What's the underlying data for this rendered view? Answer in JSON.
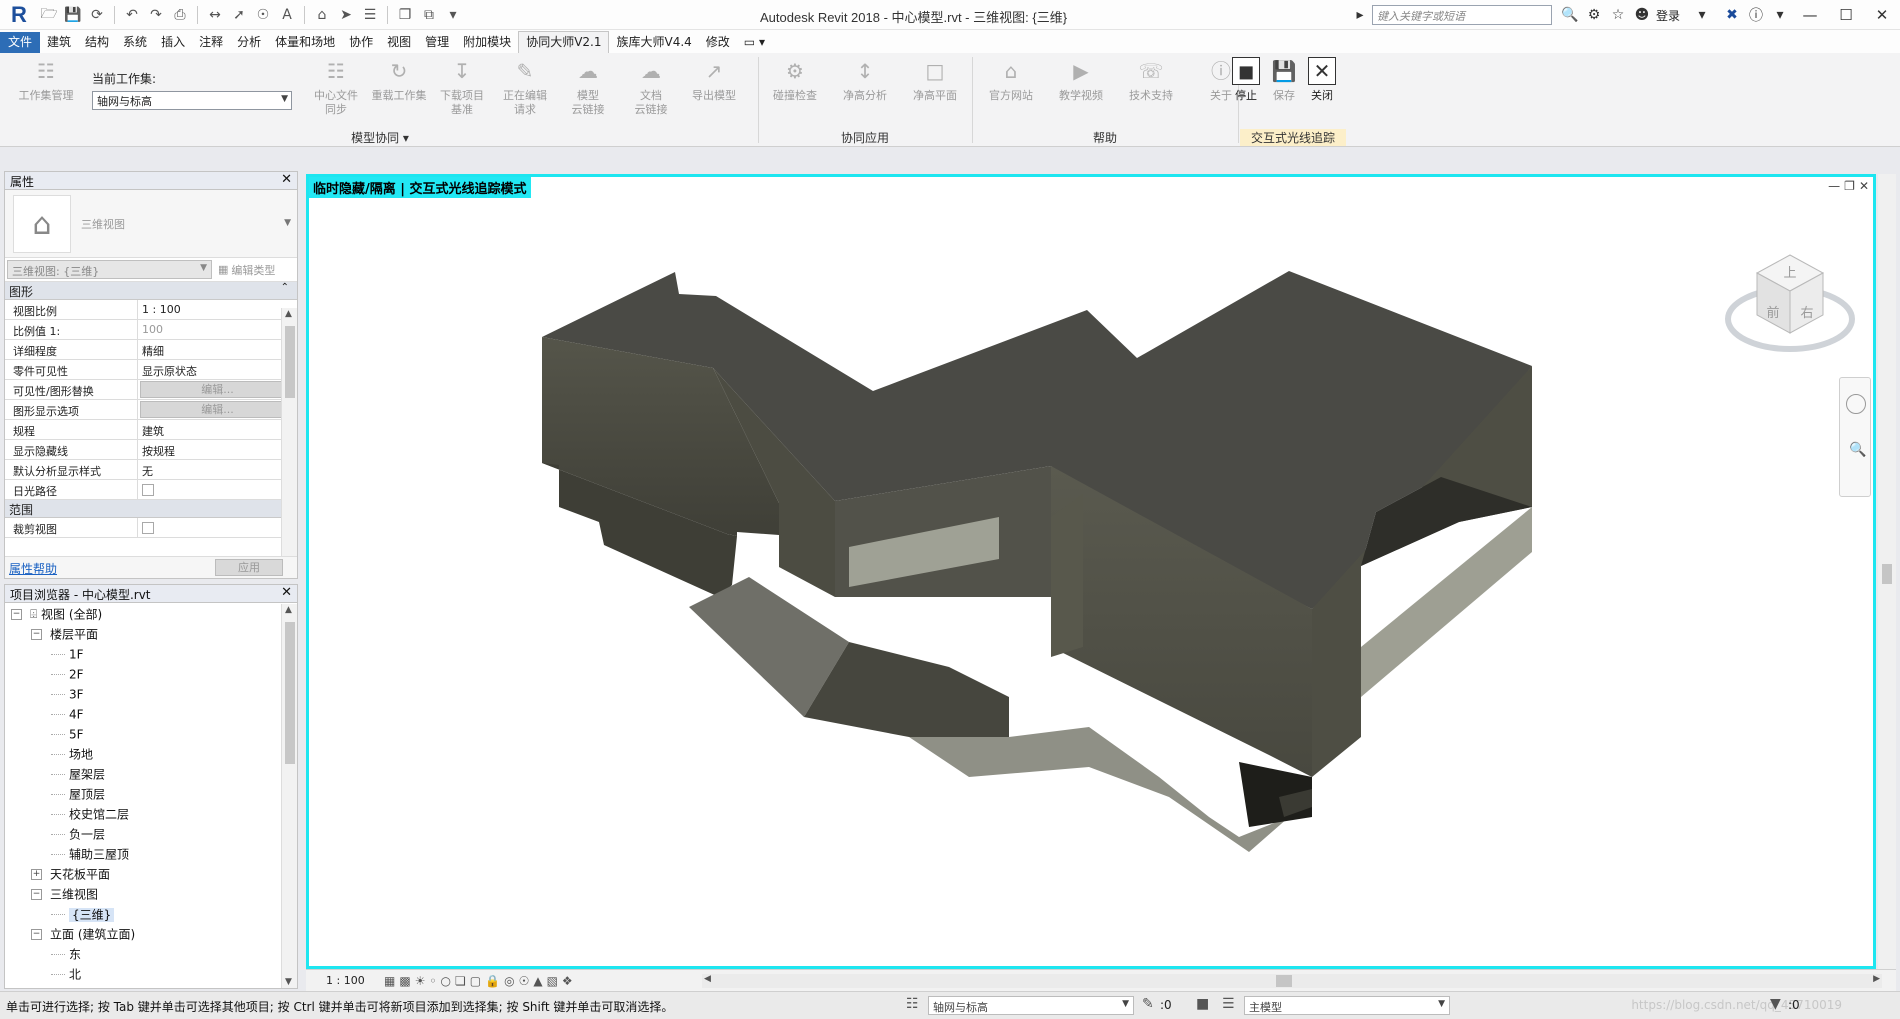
{
  "app": {
    "logo": "R",
    "title": "Autodesk Revit 2018 -    中心模型.rvt - 三维视图: {三维}",
    "search_placeholder": "键入关键字或短语",
    "login": "登录",
    "qat_icons": [
      "open-icon",
      "save-icon",
      "sync-icon",
      "undo-icon",
      "redo-icon",
      "print-icon",
      "measure-icon",
      "text-icon",
      "3d-view-icon",
      "section-icon",
      "close-hidden-icon",
      "switch-windows-icon",
      "dropdown-icon"
    ]
  },
  "tabs": [
    "文件",
    "建筑",
    "结构",
    "系统",
    "插入",
    "注释",
    "分析",
    "体量和场地",
    "协作",
    "视图",
    "管理",
    "附加模块",
    "协同大师V2.1",
    "族库大师V4.4",
    "修改"
  ],
  "active_tab": "协同大师V2.1",
  "ribbon": {
    "workset_manage": "工作集管理",
    "current_workset_label": "当前工作集:",
    "current_workset_value": "轴网与标高",
    "group1": [
      {
        "label": "中心文件\n同步"
      },
      {
        "label": "重载工作集"
      },
      {
        "label": "下载项目\n基准"
      },
      {
        "label": "正在编辑\n请求"
      },
      {
        "label": "模型\n云链接"
      },
      {
        "label": "文档\n云链接"
      },
      {
        "label": "导出模型"
      }
    ],
    "group1_title": "模型协同",
    "group2": [
      {
        "label": "碰撞检查"
      },
      {
        "label": "净高分析"
      },
      {
        "label": "净高平面"
      }
    ],
    "group2_title": "协同应用",
    "group3": [
      {
        "label": "官方网站"
      },
      {
        "label": "教学视频"
      },
      {
        "label": "技术支持"
      },
      {
        "label": "关于"
      }
    ],
    "group3_title": "帮助",
    "group4": [
      {
        "label": "停止"
      },
      {
        "label": "保存"
      },
      {
        "label": "关闭"
      }
    ],
    "group4_title": "交互式光线追踪"
  },
  "properties": {
    "title": "属性",
    "type_name": "三维视图",
    "instance_select": "三维视图: {三维}",
    "edit_type": "编辑类型",
    "group_graphics": "图形",
    "rows": [
      {
        "k": "视图比例",
        "v": "1 : 100"
      },
      {
        "k": "比例值 1:",
        "v": "100"
      },
      {
        "k": "详细程度",
        "v": "精细"
      },
      {
        "k": "零件可见性",
        "v": "显示原状态"
      },
      {
        "k": "可见性/图形替换",
        "v": "编辑..."
      },
      {
        "k": "图形显示选项",
        "v": "编辑..."
      },
      {
        "k": "规程",
        "v": "建筑"
      },
      {
        "k": "显示隐藏线",
        "v": "按规程"
      },
      {
        "k": "默认分析显示样式",
        "v": "无"
      },
      {
        "k": "日光路径",
        "v": ""
      }
    ],
    "group_extent": "范围",
    "extent_rows": [
      {
        "k": "裁剪视图",
        "v": ""
      }
    ],
    "help": "属性帮助",
    "apply": "应用"
  },
  "browser": {
    "title": "项目浏览器 - 中心模型.rvt",
    "items": [
      {
        "label": "视图 (全部)",
        "level": 0,
        "exp": "−",
        "icon": true
      },
      {
        "label": "楼层平面",
        "level": 1,
        "exp": "−"
      },
      {
        "label": "1F",
        "level": 2
      },
      {
        "label": "2F",
        "level": 2
      },
      {
        "label": "3F",
        "level": 2
      },
      {
        "label": "4F",
        "level": 2
      },
      {
        "label": "5F",
        "level": 2
      },
      {
        "label": "场地",
        "level": 2
      },
      {
        "label": "屋架层",
        "level": 2
      },
      {
        "label": "屋顶层",
        "level": 2
      },
      {
        "label": "校史馆二层",
        "level": 2
      },
      {
        "label": "负一层",
        "level": 2
      },
      {
        "label": "辅助三屋顶",
        "level": 2
      },
      {
        "label": "天花板平面",
        "level": 1,
        "exp": "+"
      },
      {
        "label": "三维视图",
        "level": 1,
        "exp": "−"
      },
      {
        "label": "{三维}",
        "level": 2,
        "sel": true
      },
      {
        "label": "立面 (建筑立面)",
        "level": 1,
        "exp": "−"
      },
      {
        "label": "东",
        "level": 2
      },
      {
        "label": "北",
        "level": 2
      }
    ]
  },
  "view": {
    "label": "临时隐藏/隔离  |  交互式光线追踪模式",
    "scale": "1 : 100",
    "viewcube_top": "上",
    "viewcube_front": "前",
    "viewcube_right": "右"
  },
  "status": {
    "text": "单击可进行选择; 按 Tab 键并单击可选择其他项目; 按 Ctrl 键并单击可将新项目添加到选择集; 按 Shift 键并单击可取消选择。",
    "workset": "轴网与标高",
    "count1": ":0",
    "model": "主模型",
    "count2": ":0",
    "watermark": "https://blog.csdn.net/qq_45710019"
  }
}
